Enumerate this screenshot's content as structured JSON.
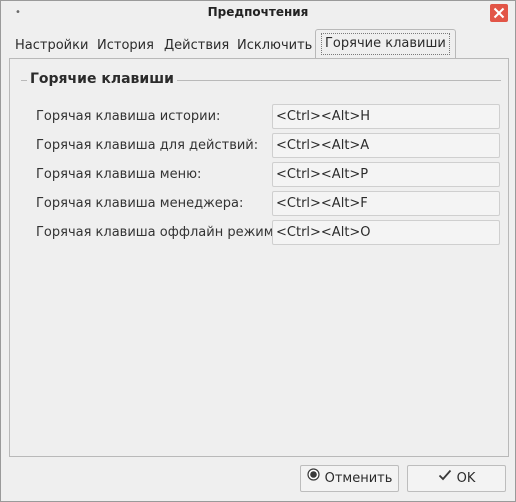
{
  "window": {
    "title": "Предпочтения",
    "accent": "#e25547"
  },
  "tabs": [
    {
      "label": "Настройки"
    },
    {
      "label": "История"
    },
    {
      "label": "Действия"
    },
    {
      "label": "Исключить"
    },
    {
      "label": "Горячие клавиши",
      "active": true
    }
  ],
  "hotkeys": {
    "group_title": "Горячие клавиши",
    "rows": [
      {
        "label": "Горячая клавиша истории:",
        "value": "<Ctrl><Alt>H"
      },
      {
        "label": "Горячая клавиша для действий:",
        "value": "<Ctrl><Alt>A"
      },
      {
        "label": "Горячая клавиша меню:",
        "value": "<Ctrl><Alt>P"
      },
      {
        "label": "Горячая клавиша менеджера:",
        "value": "<Ctrl><Alt>F"
      },
      {
        "label": "Горячая клавиша оффлайн режима:",
        "value": "<Ctrl><Alt>O"
      }
    ]
  },
  "buttons": {
    "cancel_label": "Отменить",
    "cancel_icon": "cancel-circle-icon",
    "ok_label": "OK",
    "ok_icon": "checkmark-icon"
  }
}
